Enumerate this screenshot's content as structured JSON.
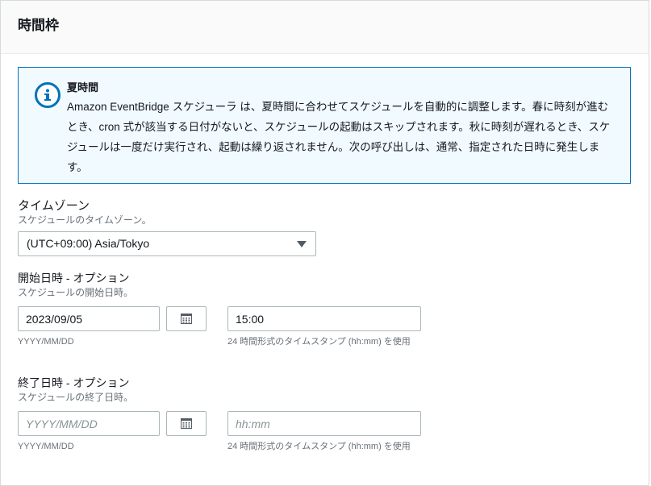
{
  "panel": {
    "title": "時間枠"
  },
  "info": {
    "title": "夏時間",
    "body": "Amazon EventBridge スケジューラ は、夏時間に合わせてスケジュールを自動的に調整します。春に時刻が進むとき、cron 式が該当する日付がないと、スケジュールの起動はスキップされます。秋に時刻が遅れるとき、スケジュールは一度だけ実行され、起動は繰り返されません。次の呼び出しは、通常、指定された日時に発生します。",
    "icon": "info-icon"
  },
  "timezone": {
    "label": "タイムゾーン",
    "description": "スケジュールのタイムゾーン。",
    "selected": "(UTC+09:00) Asia/Tokyo"
  },
  "start": {
    "label": "開始日時 - オプション",
    "description": "スケジュールの開始日時。",
    "date_value": "2023/09/05",
    "date_placeholder": "YYYY/MM/DD",
    "date_hint": "YYYY/MM/DD",
    "time_value": "15:00",
    "time_placeholder": "hh:mm",
    "time_hint": "24 時間形式のタイムスタンプ (hh:mm) を使用"
  },
  "end": {
    "label": "終了日時 - オプション",
    "description": "スケジュールの終了日時。",
    "date_value": "",
    "date_placeholder": "YYYY/MM/DD",
    "date_hint": "YYYY/MM/DD",
    "time_value": "",
    "time_placeholder": "hh:mm",
    "time_hint": "24 時間形式のタイムスタンプ (hh:mm) を使用"
  },
  "colors": {
    "accent": "#0073bb",
    "info_bg": "#f1faff",
    "border": "#aab7b8",
    "muted_text": "#687078"
  }
}
